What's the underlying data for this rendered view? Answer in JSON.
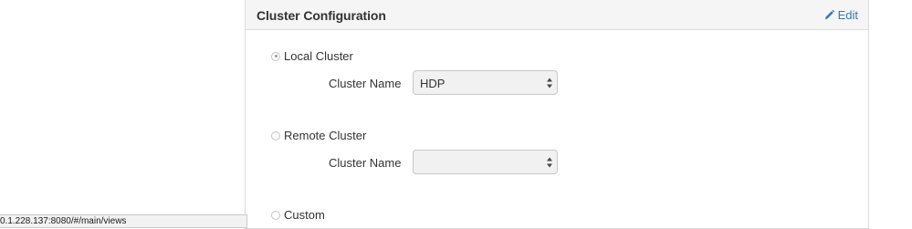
{
  "panel": {
    "title": "Cluster Configuration",
    "edit_label": "Edit"
  },
  "options": [
    {
      "label": "Local Cluster",
      "checked": true,
      "field_label": "Cluster Name",
      "select_value": "HDP"
    },
    {
      "label": "Remote Cluster",
      "checked": false,
      "field_label": "Cluster Name",
      "select_value": ""
    },
    {
      "label": "Custom",
      "checked": false
    }
  ],
  "status_bar": {
    "url": "0.1.228.137:8080/#/main/views"
  },
  "icons": {
    "edit": "pencil-icon",
    "select_arrows": "up-down-arrows-icon"
  },
  "colors": {
    "link": "#337ab7",
    "heading_bg": "#f5f5f5",
    "border": "#dddddd",
    "select_bg": "#f1f1f1"
  }
}
